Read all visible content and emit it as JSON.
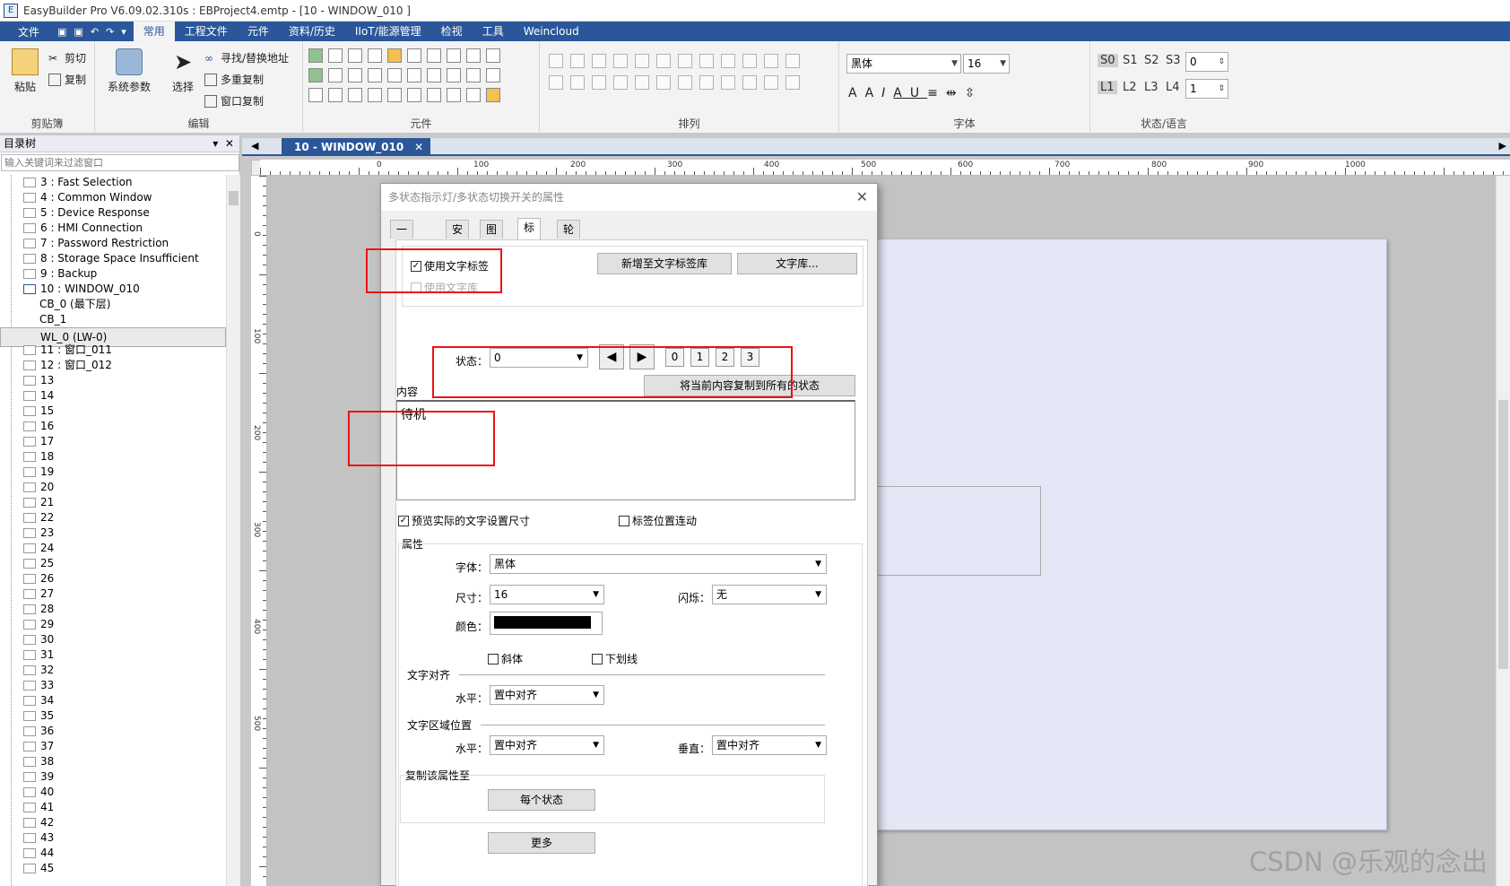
{
  "titlebar": {
    "text": "EasyBuilder Pro V6.09.02.310s : EBProject4.emtp - [10 - WINDOW_010 ]"
  },
  "menubar": {
    "file": "文件",
    "tabs": [
      "常用",
      "工程文件",
      "元件",
      "资料/历史",
      "IIoT/能源管理",
      "检视",
      "工具",
      "Weincloud"
    ]
  },
  "ribbon": {
    "clipboard": {
      "paste": "粘贴",
      "cut": "剪切",
      "copy": "复制",
      "group": "剪贴簿"
    },
    "edit": {
      "system_params": "系统参数",
      "select": "选择",
      "find_replace": "寻找/替换地址",
      "multi_copy": "多重复制",
      "window_copy": "窗口复制",
      "group": "编辑"
    },
    "objects": {
      "group": "元件"
    },
    "arrange": {
      "group": "排列"
    },
    "font": {
      "font_name": "黑体",
      "font_size": "16",
      "group": "字体"
    },
    "state_lang": {
      "states": [
        "S0",
        "S1",
        "S2",
        "S3"
      ],
      "state_value": "0",
      "langs": [
        "L1",
        "L2",
        "L3",
        "L4"
      ],
      "lang_value": "1",
      "group": "状态/语言"
    }
  },
  "sidebar": {
    "title": "目录树",
    "filter_placeholder": "输入关键词来过滤窗口",
    "items": [
      "3 : Fast Selection",
      "4 : Common Window",
      "5 : Device Response",
      "6 : HMI Connection",
      "7 : Password Restriction",
      "8 : Storage Space Insufficient",
      "9 : Backup",
      "10 : WINDOW_010",
      "CB_0 (最下层)",
      "CB_1",
      "WL_0 (LW-0)",
      "11 : 窗口_011",
      "12 : 窗口_012",
      "13",
      "14",
      "15",
      "16",
      "17",
      "18",
      "19",
      "20",
      "21",
      "22",
      "23",
      "24",
      "25",
      "26",
      "27",
      "28",
      "29",
      "30",
      "31",
      "32",
      "33",
      "34",
      "35",
      "36",
      "37",
      "38",
      "39",
      "40",
      "41",
      "42",
      "43",
      "44",
      "45"
    ]
  },
  "document": {
    "tab": "10 - WINDOW_010"
  },
  "ruler": {
    "h_labels": [
      "0",
      "100",
      "200",
      "300",
      "400",
      "500",
      "600",
      "700",
      "800",
      "900",
      "1000"
    ],
    "v_labels": [
      "0",
      "100",
      "200",
      "300",
      "400",
      "500"
    ]
  },
  "dialog": {
    "title": "多状态指示灯/多状态切换开关的属性",
    "tabs": [
      "一般属性",
      "安全",
      "图片",
      "标签",
      "轮廓"
    ],
    "use_text_label": "使用文字标签",
    "use_text_library": "使用文字库",
    "add_to_text_lib": "新增至文字标签库",
    "text_library": "文字库...",
    "state_label": "状态：",
    "state_value": "0",
    "state_buttons": [
      "0",
      "1",
      "2",
      "3"
    ],
    "copy_to_all": "将当前内容复制到所有的状态",
    "content_label": "内容",
    "content_value": "待机",
    "preview_actual_size": "预览实际的文字设置尺寸",
    "label_position_link": "标签位置连动",
    "attributes": "属性",
    "font_label": "字体：",
    "font_value": "黑体",
    "size_label": "尺寸：",
    "size_value": "16",
    "blink_label": "闪烁：",
    "blink_value": "无",
    "color_label": "颜色：",
    "color_hex": "#000000",
    "italic": "斜体",
    "underline": "下划线",
    "text_align": "文字对齐",
    "horizontal_label": "水平：",
    "horizontal_value": "置中对齐",
    "text_area_pos": "文字区域位置",
    "horizontal2_value": "置中对齐",
    "vertical_label": "垂直：",
    "vertical_value": "置中对齐",
    "copy_attr_to": "复制该属性至",
    "each_state": "每个状态",
    "more": "更多"
  },
  "watermark": "CSDN @乐观的念出",
  "colors": {
    "accent": "#2b579a",
    "highlight": "#e11111"
  }
}
